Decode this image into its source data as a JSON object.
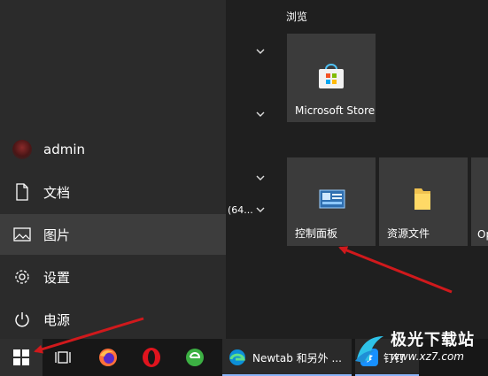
{
  "start_menu": {
    "left_rail": {
      "user": {
        "name": "admin",
        "icon": "user-avatar"
      },
      "items": [
        {
          "label": "文档",
          "icon": "document-icon"
        },
        {
          "label": "图片",
          "icon": "pictures-icon",
          "active": true
        },
        {
          "label": "设置",
          "icon": "gear-icon"
        },
        {
          "label": "电源",
          "icon": "power-icon"
        }
      ]
    },
    "partial_text": "(64...",
    "group": {
      "title": "浏览"
    },
    "tiles": [
      {
        "label": "Microsoft Store",
        "icon": "store-icon"
      },
      {
        "label": "控制面板",
        "icon": "control-panel-icon"
      },
      {
        "label": "资源文件",
        "icon": "folder-icon"
      },
      {
        "label": "Op",
        "icon": "opera-icon"
      }
    ]
  },
  "taskbar": {
    "start_icon": "windows-logo-icon",
    "task_view_icon": "task-view-icon",
    "apps": [
      {
        "icon": "firefox-icon"
      },
      {
        "icon": "opera-icon"
      },
      {
        "icon": "green-browser-icon"
      }
    ],
    "open_windows": [
      {
        "label": "Newtab 和另外 ...",
        "icon": "edge-icon"
      },
      {
        "label": "钉钉",
        "icon": "dingtalk-icon"
      }
    ]
  },
  "watermark": {
    "line1": "极光下载站",
    "line2": "www.xz7.com"
  },
  "colors": {
    "accent": "#d0191c",
    "tile": "#3b3b3b",
    "taskbar": "#171717"
  }
}
